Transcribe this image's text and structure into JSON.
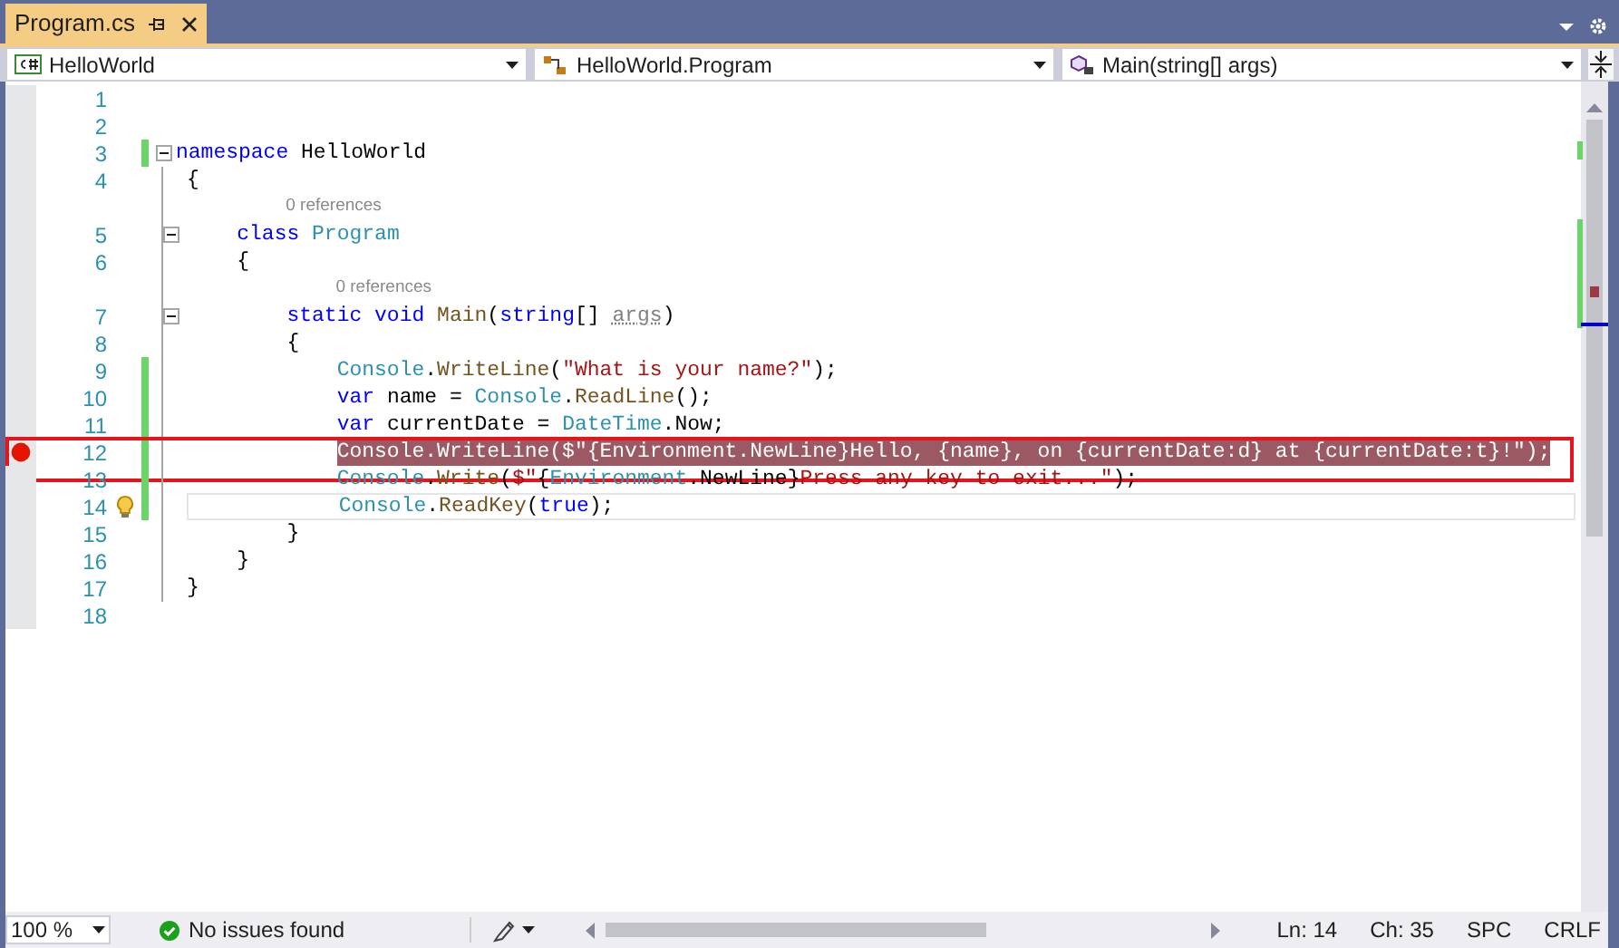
{
  "tab": {
    "title": "Program.cs",
    "selected": true
  },
  "nav": {
    "project": "HelloWorld",
    "type": "HelloWorld.Program",
    "member": "Main(string[] args)"
  },
  "lines": [
    {
      "kind": "code",
      "number": "1",
      "changed": false,
      "breakpoint": false,
      "lightbulb": false,
      "current": false,
      "framed": false
    },
    {
      "kind": "code",
      "number": "2",
      "changed": false,
      "breakpoint": false,
      "lightbulb": false,
      "current": false,
      "framed": false
    },
    {
      "kind": "code",
      "number": "3",
      "tokens": [
        {
          "kind": "kw",
          "text": "namespace"
        },
        {
          "kind": "plain",
          "text": " HelloWorld"
        }
      ],
      "changed": true,
      "breakpoint": false,
      "expanded": true,
      "lightbulb": false,
      "current": false,
      "framed": false
    },
    {
      "kind": "code",
      "number": "4",
      "tokens": [
        {
          "kind": "plain",
          "text": "{"
        }
      ],
      "changed": false,
      "breakpoint": false,
      "lightbulb": false,
      "current": false,
      "framed": false
    },
    {
      "kind": "lens",
      "text": "0 references"
    },
    {
      "kind": "code",
      "number": "5",
      "tokens": [
        {
          "kind": "kw",
          "text": "    class "
        },
        {
          "kind": "type",
          "text": "Program"
        }
      ],
      "changed": false,
      "breakpoint": false,
      "expanded": true,
      "lightbulb": false,
      "current": false,
      "framed": false
    },
    {
      "kind": "code",
      "number": "6",
      "tokens": [
        {
          "kind": "plain",
          "text": "    {"
        }
      ],
      "changed": false,
      "breakpoint": false,
      "lightbulb": false,
      "current": false,
      "framed": false
    },
    {
      "kind": "lens",
      "text": "0 references"
    },
    {
      "kind": "code",
      "number": "7",
      "tokens": [
        {
          "kind": "kw",
          "text": "        static void "
        },
        {
          "kind": "method",
          "text": "Main"
        },
        {
          "kind": "plain",
          "text": "("
        },
        {
          "kind": "kw",
          "text": "string"
        },
        {
          "kind": "plain",
          "text": "[] "
        },
        {
          "kind": "unused",
          "text": "args"
        },
        {
          "kind": "plain",
          "text": ")"
        }
      ],
      "changed": false,
      "breakpoint": false,
      "expanded": true,
      "lightbulb": false,
      "current": false,
      "framed": false
    },
    {
      "kind": "code",
      "number": "8",
      "tokens": [
        {
          "kind": "plain",
          "text": "        {"
        }
      ],
      "changed": false,
      "breakpoint": false,
      "lightbulb": false,
      "current": false,
      "framed": false
    },
    {
      "kind": "code",
      "number": "9",
      "tokens": [
        {
          "kind": "type",
          "text": "            Console"
        },
        {
          "kind": "plain",
          "text": "."
        },
        {
          "kind": "method",
          "text": "WriteLine"
        },
        {
          "kind": "plain",
          "text": "("
        },
        {
          "kind": "str",
          "text": "\"What is your name?\""
        },
        {
          "kind": "plain",
          "text": ");"
        }
      ],
      "changed": true,
      "breakpoint": false,
      "lightbulb": false,
      "current": false,
      "framed": false
    },
    {
      "kind": "code",
      "number": "10",
      "tokens": [
        {
          "kind": "kw",
          "text": "            var"
        },
        {
          "kind": "plain",
          "text": " name = "
        },
        {
          "kind": "type",
          "text": "Console"
        },
        {
          "kind": "plain",
          "text": "."
        },
        {
          "kind": "method",
          "text": "ReadLine"
        },
        {
          "kind": "plain",
          "text": "();"
        }
      ],
      "changed": true,
      "breakpoint": false,
      "lightbulb": false,
      "current": false,
      "framed": false
    },
    {
      "kind": "code",
      "number": "11",
      "tokens": [
        {
          "kind": "kw",
          "text": "            var"
        },
        {
          "kind": "plain",
          "text": " currentDate = "
        },
        {
          "kind": "type",
          "text": "DateTime"
        },
        {
          "kind": "plain",
          "text": ".Now;"
        }
      ],
      "changed": true,
      "breakpoint": false,
      "lightbulb": false,
      "current": false,
      "framed": false
    },
    {
      "kind": "code",
      "number": "12",
      "tokens": [
        {
          "kind": "plain",
          "text": "            Console.WriteLine($\"{Environment.NewLine}Hello, {name}, on {currentDate:d} at {currentDate:t}!\");"
        }
      ],
      "changed": true,
      "breakpoint": true,
      "lightbulb": false,
      "current": false,
      "framed": true
    },
    {
      "kind": "code",
      "number": "13",
      "tokens": [
        {
          "kind": "type",
          "text": "            Console"
        },
        {
          "kind": "plain",
          "text": "."
        },
        {
          "kind": "method",
          "text": "Write"
        },
        {
          "kind": "plain",
          "text": "("
        },
        {
          "kind": "str",
          "text": "$\""
        },
        {
          "kind": "plain",
          "text": "{"
        },
        {
          "kind": "type",
          "text": "Environment"
        },
        {
          "kind": "plain",
          "text": ".NewLine}"
        },
        {
          "kind": "str",
          "text": "Press any key to exit...\""
        },
        {
          "kind": "plain",
          "text": ");"
        }
      ],
      "changed": true,
      "breakpoint": false,
      "lightbulb": false,
      "current": false,
      "framed": false
    },
    {
      "kind": "code",
      "number": "14",
      "tokens": [
        {
          "kind": "type",
          "text": "            Console"
        },
        {
          "kind": "plain",
          "text": "."
        },
        {
          "kind": "method",
          "text": "ReadKey"
        },
        {
          "kind": "plain",
          "text": "("
        },
        {
          "kind": "kw",
          "text": "true"
        },
        {
          "kind": "plain",
          "text": ");"
        }
      ],
      "changed": true,
      "breakpoint": false,
      "lightbulb": true,
      "current": true,
      "framed": false
    },
    {
      "kind": "code",
      "number": "15",
      "tokens": [
        {
          "kind": "plain",
          "text": "        }"
        }
      ],
      "changed": false,
      "breakpoint": false,
      "lightbulb": false,
      "current": false,
      "framed": false
    },
    {
      "kind": "code",
      "number": "16",
      "tokens": [
        {
          "kind": "plain",
          "text": "    }"
        }
      ],
      "changed": false,
      "breakpoint": false,
      "lightbulb": false,
      "current": false,
      "framed": false
    },
    {
      "kind": "code",
      "number": "17",
      "tokens": [
        {
          "kind": "plain",
          "text": "}"
        }
      ],
      "changed": false,
      "breakpoint": false,
      "lightbulb": false,
      "current": false,
      "framed": false
    },
    {
      "kind": "code",
      "number": "18",
      "changed": false,
      "breakpoint": false,
      "lightbulb": false,
      "current": false,
      "framed": false
    }
  ],
  "status": {
    "zoom": "100 %",
    "issues": "No issues found",
    "line": "Ln: 14",
    "column": "Ch: 35",
    "whitespace": "SPC",
    "line_ending": "CRLF"
  }
}
